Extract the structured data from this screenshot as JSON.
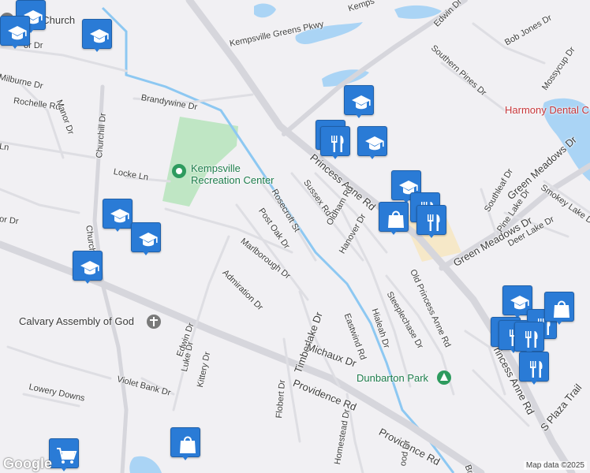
{
  "streets": [
    {
      "id": "kempsville-greens-pkwy",
      "name": "Kempsville Greens Pkwy"
    },
    {
      "id": "kemps",
      "name": "Kemps"
    },
    {
      "id": "edwin-dr-n",
      "name": "Edwin Dr"
    },
    {
      "id": "bob-jones-dr",
      "name": "Bob Jones Dr"
    },
    {
      "id": "southern-pines-dr",
      "name": "Southern Pines Dr"
    },
    {
      "id": "mossycup-dr",
      "name": "Mossycup Dr"
    },
    {
      "id": "milburne-dr",
      "name": "Milburne Dr"
    },
    {
      "id": "rochelle-rd",
      "name": "Rochelle Rd"
    },
    {
      "id": "manor-dr",
      "name": "Manor Dr"
    },
    {
      "id": "brandywine-dr",
      "name": "Brandywine Dr"
    },
    {
      "id": "churchill-dr",
      "name": "Churchill Dr"
    },
    {
      "id": "locke-ln",
      "name": "Locke Ln"
    },
    {
      "id": "ln-edge",
      "name": "Ln"
    },
    {
      "id": "or-dr-edge",
      "name": "or Dr"
    },
    {
      "id": "or-dr-top",
      "name": "or Dr"
    },
    {
      "id": "princess-anne-rd",
      "name": "Princess Anne Rd"
    },
    {
      "id": "sussex-rd",
      "name": "Sussex Rd"
    },
    {
      "id": "oldham-rd",
      "name": "Oldham Rd"
    },
    {
      "id": "hanover-dr",
      "name": "Hanover Dr"
    },
    {
      "id": "rosecroft-st",
      "name": "Rosecroft St"
    },
    {
      "id": "post-oak-dr",
      "name": "Post Oak Dr"
    },
    {
      "id": "marlborough-dr",
      "name": "Marlborough Dr"
    },
    {
      "id": "admiration-dr",
      "name": "Admiration Dr"
    },
    {
      "id": "churchill-dr-2",
      "name": "Churchill Dr"
    },
    {
      "id": "edwin-dr-s",
      "name": "Edwin Dr"
    },
    {
      "id": "luke-dr",
      "name": "Luke Dr"
    },
    {
      "id": "kittery-dr",
      "name": "Kittery Dr"
    },
    {
      "id": "violet-bank-dr",
      "name": "Violet Bank Dr"
    },
    {
      "id": "lowery-downs",
      "name": "Lowery Downs"
    },
    {
      "id": "timberlake-dr",
      "name": "Timberlake Dr"
    },
    {
      "id": "michaux-dr",
      "name": "Michaux Dr"
    },
    {
      "id": "eastwind-rd",
      "name": "Eastwind Rd"
    },
    {
      "id": "steeplechase-dr",
      "name": "Steeplechase Dr"
    },
    {
      "id": "hialeah-dr",
      "name": "Hialeah Dr"
    },
    {
      "id": "old-princess-anne-rd",
      "name": "Old Princess Anne Rd"
    },
    {
      "id": "flobert-dr",
      "name": "Flobert Dr"
    },
    {
      "id": "homestead-dr",
      "name": "Homestead Dr"
    },
    {
      "id": "providence-rd-1",
      "name": "Providence Rd"
    },
    {
      "id": "providence-rd-2",
      "name": "Providence Rd"
    },
    {
      "id": "princess-anne-rd-2",
      "name": "Princess Anne Rd"
    },
    {
      "id": "s-plaza-trail",
      "name": "S Plaza Trail"
    },
    {
      "id": "green-meadows-dr-1",
      "name": "Green Meadows Dr"
    },
    {
      "id": "green-meadows-dr-2",
      "name": "Green Meadows Dr"
    },
    {
      "id": "southleaf-dr",
      "name": "Southleaf Dr"
    },
    {
      "id": "pine-lake-dr",
      "name": "Pine Lake Dr"
    },
    {
      "id": "deer-lake-dr",
      "name": "Deer Lake Dr"
    },
    {
      "id": "smokey-lake-dr",
      "name": "Smokey Lake Dr"
    },
    {
      "id": "ood-dr",
      "name": "ood Dr"
    },
    {
      "id": "br",
      "name": "Br"
    }
  ],
  "pois": {
    "recreation_center": "Kempsville\nRecreation Center",
    "church_top": "Rock Church",
    "calvary": "Calvary Assembly of God",
    "dunbarton": "Dunbarton Park",
    "harmony": "Harmony Dental C"
  },
  "pin_icons": [
    "school-icon",
    "restaurant-icon",
    "shopping-icon",
    "shopping-cart-icon"
  ],
  "footer": {
    "logo": "Google",
    "attribution": "Map data ©2025"
  },
  "colors": {
    "pin_blue": "#2a7bd6",
    "park_green": "#bfe6c4",
    "water_blue": "#aad4f5",
    "road_gray": "#d6d6dc",
    "commercial": "#f6e8c8"
  }
}
